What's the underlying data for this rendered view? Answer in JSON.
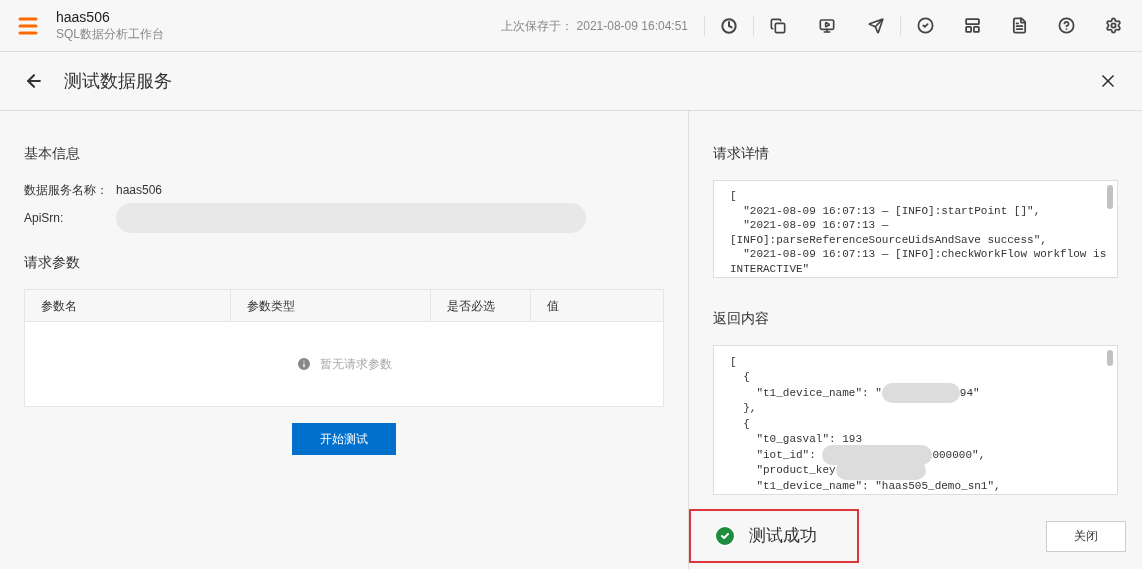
{
  "header": {
    "app_name": "haas506",
    "subtitle": "SQL数据分析工作台",
    "saved_label": "上次保存于：",
    "saved_time": "2021-08-09 16:04:51"
  },
  "page": {
    "title": "测试数据服务"
  },
  "basic_info": {
    "heading": "基本信息",
    "fields": [
      {
        "label": "数据服务名称：",
        "value": "haas506",
        "redacted": false
      },
      {
        "label": "ApiSrn:",
        "redacted": true
      }
    ]
  },
  "request_params": {
    "heading": "请求参数",
    "columns": [
      "参数名",
      "参数类型",
      "是否必选",
      "值"
    ],
    "empty_text": "暂无请求参数"
  },
  "start_button": "开始测试",
  "request_details": {
    "heading": "请求详情",
    "lines": [
      "[",
      "  \"2021-08-09 16:07:13 — [INFO]:startPoint []\",",
      "  \"2021-08-09 16:07:13 —",
      "[INFO]:parseReferenceSourceUidsAndSave success\",",
      "  \"2021-08-09 16:07:13 — [INFO]:checkWorkFlow workflow is",
      "INTERACTIVE\""
    ]
  },
  "response": {
    "heading": "返回内容",
    "lines": [
      {
        "parts": [
          "["
        ],
        "redacted": false
      },
      {
        "parts": [
          "  {"
        ],
        "redacted": false
      },
      {
        "parts": [
          "    \"t1_device_name\": \"",
          "94\""
        ],
        "redacted": true
      },
      {
        "parts": [
          "  },"
        ],
        "redacted": false
      },
      {
        "parts": [
          "  {"
        ],
        "redacted": false
      },
      {
        "parts": [
          "    \"t0_gasval\": 193"
        ],
        "redacted": false
      },
      {
        "parts": [
          "    \"iot_id\": ",
          "000000\","
        ],
        "redacted": true
      },
      {
        "parts": [
          "    \"product_key"
        ],
        "redacted": true
      },
      {
        "parts": [
          "    \"t1_device_name\": \"haas505_demo_sn1\","
        ],
        "redacted": false
      }
    ]
  },
  "result": {
    "text": "测试成功"
  },
  "close_button": "关闭"
}
